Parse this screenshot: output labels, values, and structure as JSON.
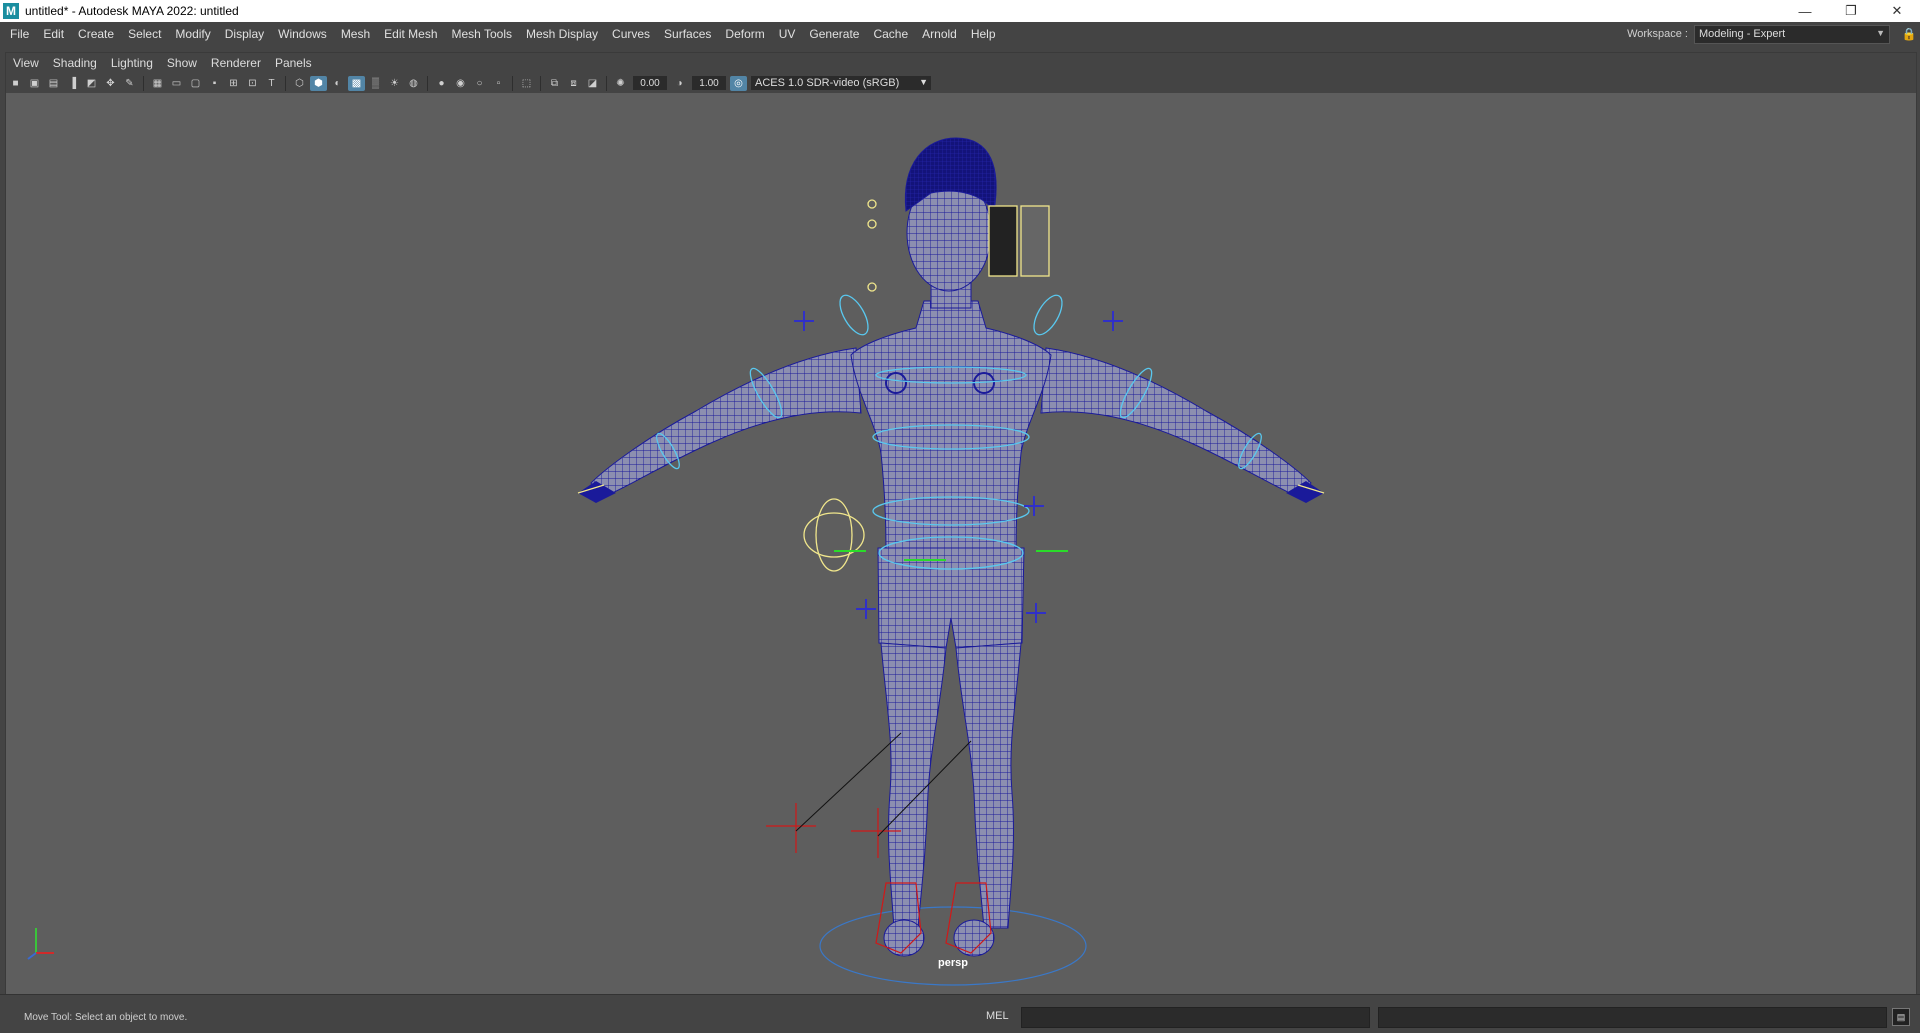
{
  "window": {
    "title": "untitled* - Autodesk MAYA 2022: untitled",
    "app_icon": "M",
    "minimize_icon": "—",
    "restore_icon": "❐",
    "close_icon": "✕"
  },
  "menubar": {
    "items": [
      "File",
      "Edit",
      "Create",
      "Select",
      "Modify",
      "Display",
      "Windows",
      "Mesh",
      "Edit Mesh",
      "Mesh Tools",
      "Mesh Display",
      "Curves",
      "Surfaces",
      "Deform",
      "UV",
      "Generate",
      "Cache",
      "Arnold",
      "Help"
    ]
  },
  "workspace": {
    "label": "Workspace :",
    "value": "Modeling - Expert",
    "lock_icon": "🔒"
  },
  "panel_menu": {
    "items": [
      "View",
      "Shading",
      "Lighting",
      "Show",
      "Renderer",
      "Panels"
    ]
  },
  "panel_toolbar": {
    "exposure": "0.00",
    "gamma": "1.00",
    "color_space": "ACES 1.0 SDR-video (sRGB)",
    "icons": [
      "camera-icon",
      "lock-camera-icon",
      "camera-attributes-icon",
      "bookmark-icon",
      "image-plane-icon",
      "2d-pan-icon",
      "grease-pencil-icon",
      "grid-icon",
      "film-gate-icon",
      "resolution-gate-icon",
      "gate-mask-icon",
      "field-chart-icon",
      "safe-action-icon",
      "safe-title-icon",
      "wireframe-icon",
      "smooth-shade-icon",
      "default-material-icon",
      "wireframe-on-shaded-icon",
      "xray-icon",
      "use-all-lights-icon",
      "textured-icon",
      "shadows-icon",
      "screen-space-ao-icon",
      "motion-blur-icon",
      "anti-aliasing-icon",
      "depth-of-field-icon",
      "isolate-select-icon",
      "xray-joints-icon",
      "xray-active-icon",
      "backface-icon"
    ]
  },
  "viewport": {
    "camera_label": "persp",
    "colors": {
      "background": "#5e5e5e",
      "mesh_wire": "#1a1a9a",
      "mesh_fill": "#8c8fb0",
      "ctrl_cyan": "#59c8ef",
      "ctrl_yellow": "#f0e68c",
      "ctrl_red": "#d11818",
      "ctrl_blue": "#3030c8"
    }
  },
  "statusbar": {
    "message": "Move Tool: Select an object to move.",
    "mel_label": "MEL",
    "script_editor_icon": "▤"
  }
}
